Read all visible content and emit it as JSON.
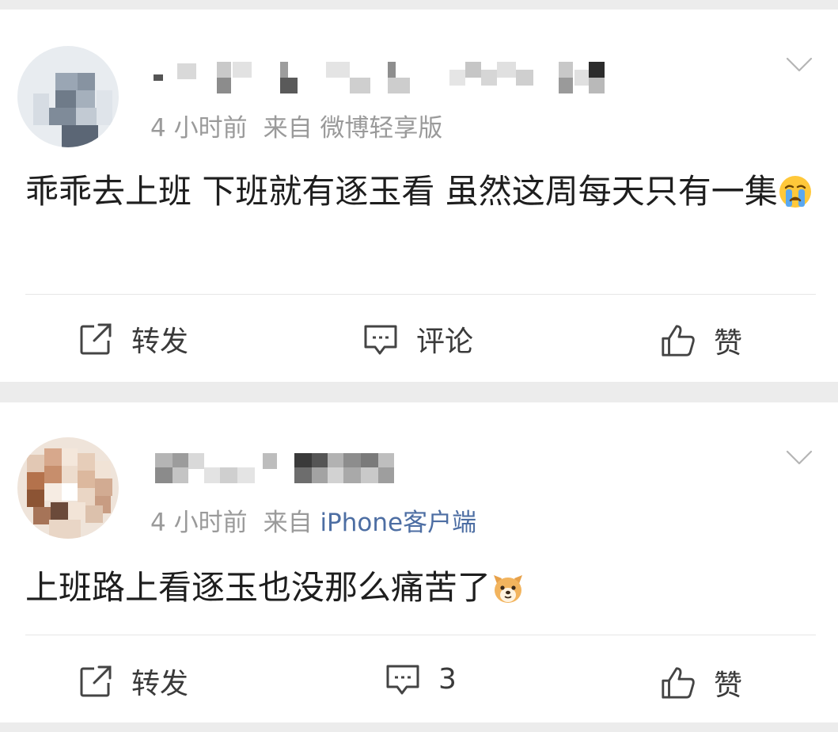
{
  "posts": [
    {
      "time": "4 小时前",
      "from_label": "来自",
      "source": "微博轻享版",
      "source_style": "plain",
      "text": "乖乖去上班 下班就有逐玉看 虽然这周每天只有一集",
      "emoji": "crying-face-emoji",
      "actions": {
        "repost": "转发",
        "comment": "评论",
        "like": "赞"
      }
    },
    {
      "time": "4 小时前",
      "from_label": "来自",
      "source": "iPhone客户端",
      "source_style": "link",
      "text": "上班路上看逐玉也没那么痛苦了",
      "emoji": "dog-face-emoji",
      "actions": {
        "repost": "转发",
        "comment": "3",
        "like": "赞"
      }
    }
  ],
  "colors": {
    "background": "#ececec",
    "card": "#ffffff",
    "meta_gray": "#9a9a9a",
    "link_blue": "#4d6ea3",
    "text": "#1e1e1e"
  },
  "icons": [
    "repost-icon",
    "comment-icon",
    "like-icon",
    "chevron-down-icon"
  ]
}
